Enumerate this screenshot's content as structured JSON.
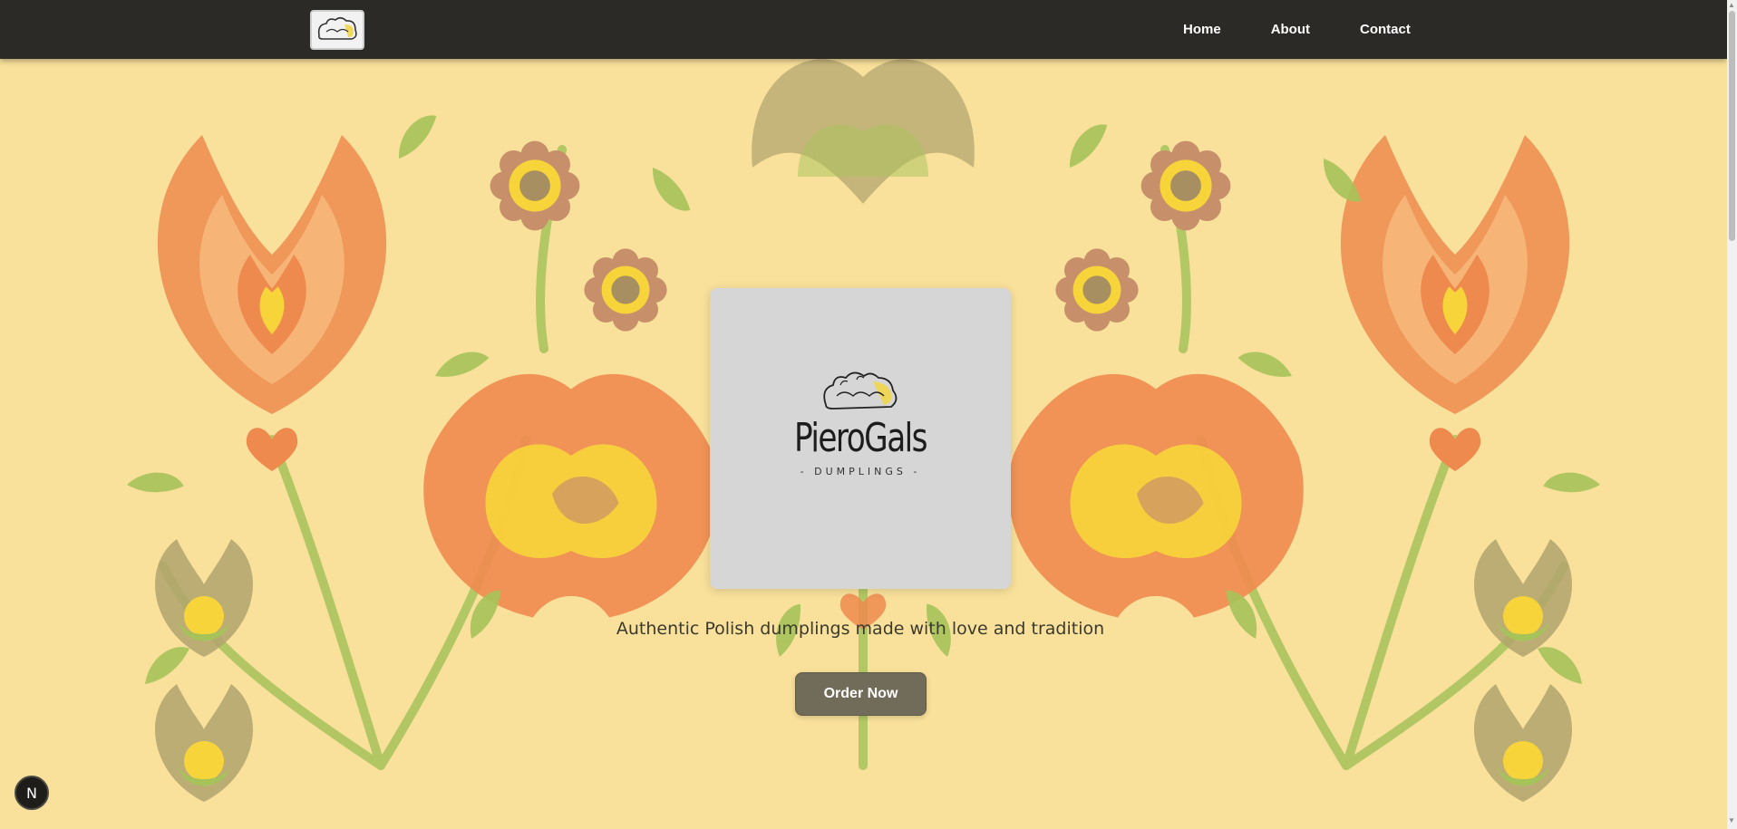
{
  "nav": {
    "links": [
      {
        "label": "Home"
      },
      {
        "label": "About"
      },
      {
        "label": "Contact"
      }
    ]
  },
  "hero": {
    "brand_name": "PieroGals",
    "brand_subtitle": "- DUMPLINGS -",
    "tagline": "Authentic Polish dumplings made with love and tradition",
    "order_button_label": "Order Now"
  },
  "dev_badge": {
    "label": "N"
  },
  "icons": {
    "nav_logo": "pierogals-logo-icon",
    "card_logo": "dumpling-icon",
    "background": "folk-floral-pattern",
    "dev_badge": "nextjs-icon"
  },
  "colors": {
    "navbar": "#2c2a27",
    "hero_background": "#f9e19b",
    "card_background": "#d6d6d6",
    "button": "#716c59",
    "flower_orange": "#ef8a4f",
    "flower_peach": "#f6b87a",
    "flower_yellow": "#f7d53a",
    "leaf_green": "#a6c35a",
    "leaf_olive": "#b1a36d",
    "petal_brown": "#c7906a"
  }
}
